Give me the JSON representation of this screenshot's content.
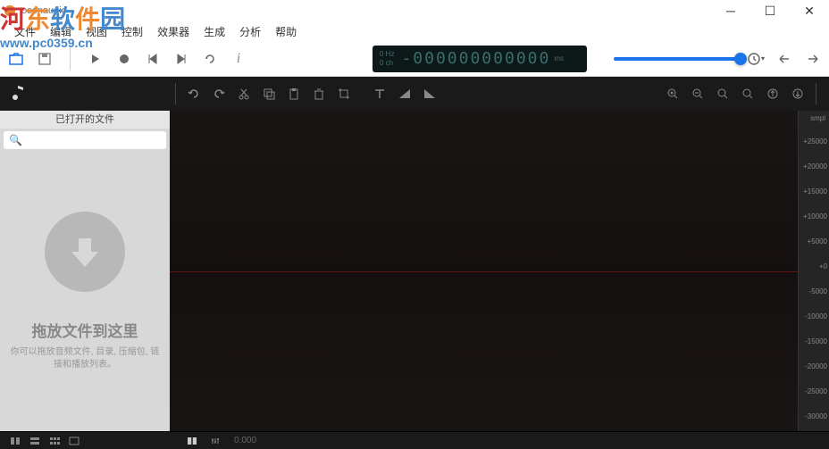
{
  "window": {
    "title": "ocenaudio"
  },
  "watermark": {
    "chars": [
      "河",
      "东",
      "软",
      "件",
      "园"
    ],
    "url": "www.pc0359.cn"
  },
  "menu": {
    "file": "文件",
    "edit": "编辑",
    "view": "视图",
    "control": "控制",
    "effects": "效果器",
    "generate": "生成",
    "analyze": "分析",
    "help": "帮助"
  },
  "lcd": {
    "hz_label": "0 Hz",
    "ch_label": "0 ch",
    "main": "-000000000000",
    "suffix": "ms"
  },
  "sidebar": {
    "header": "已打开的文件",
    "search_placeholder": "",
    "drop_title": "拖放文件到这里",
    "drop_desc": "你可以拖放音频文件, 目录, 压缩包, 链接和播放列表。"
  },
  "ruler": {
    "unit": "smpl",
    "ticks": [
      "+25000",
      "+20000",
      "+15000",
      "+10000",
      "+5000",
      "+0",
      "-5000",
      "-10000",
      "-15000",
      "-20000",
      "-25000",
      "-30000"
    ]
  },
  "statusbar": {
    "position": "0.000"
  }
}
